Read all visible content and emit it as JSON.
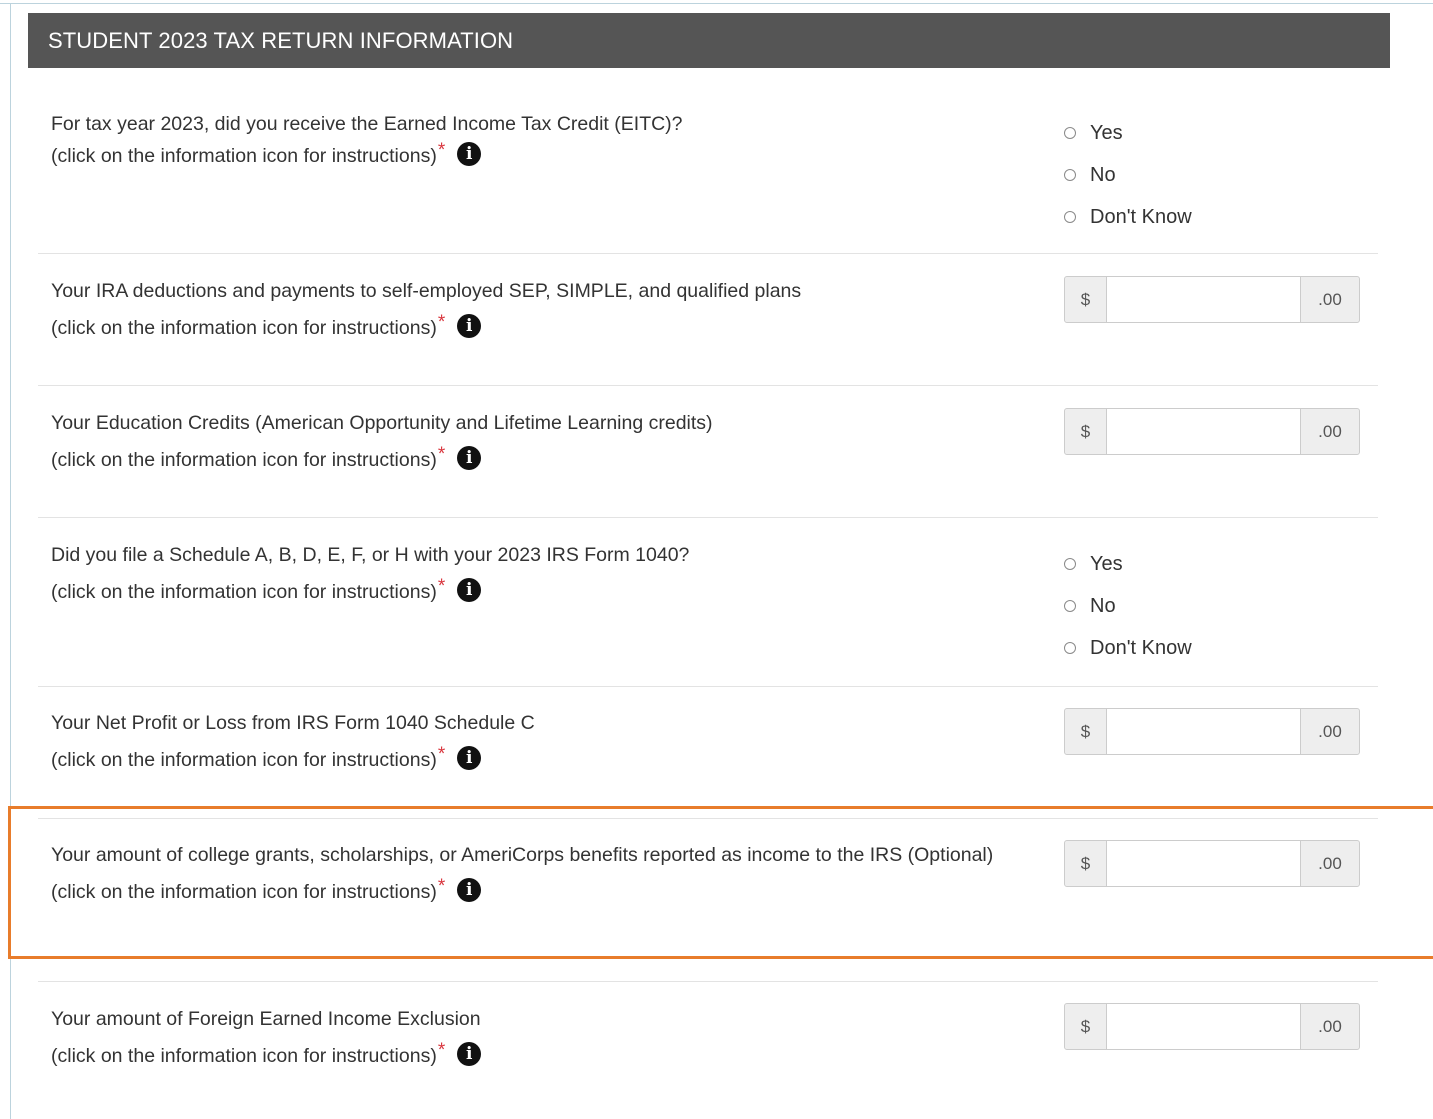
{
  "section": {
    "title": "STUDENT 2023 TAX RETURN INFORMATION"
  },
  "common": {
    "hint": "(click on the information icon for instructions)",
    "required_mark": "*",
    "info_glyph": "i",
    "currency_symbol": "$",
    "cents_suffix": ".00"
  },
  "questions": [
    {
      "text": "For tax year 2023, did you receive the Earned Income Tax Credit (EITC)?",
      "type": "radio",
      "options": [
        "Yes",
        "No",
        "Don't Know"
      ]
    },
    {
      "text": "Your IRA deductions and payments to self-employed SEP, SIMPLE, and qualified plans",
      "type": "money",
      "value": ""
    },
    {
      "text": "Your Education Credits (American Opportunity and Lifetime Learning credits)",
      "type": "money",
      "value": ""
    },
    {
      "text": "Did you file a Schedule A, B, D, E, F, or H with your 2023 IRS Form 1040?",
      "type": "radio",
      "options": [
        "Yes",
        "No",
        "Don't Know"
      ]
    },
    {
      "text": "Your Net Profit or Loss from IRS Form 1040 Schedule C",
      "type": "money",
      "value": ""
    },
    {
      "text": "Your amount of college grants, scholarships, or AmeriCorps benefits reported as income to the IRS (Optional)",
      "type": "money",
      "value": "",
      "highlighted": true
    },
    {
      "text": "Your amount of Foreign Earned Income Exclusion",
      "type": "money",
      "value": ""
    }
  ],
  "colors": {
    "header_bg": "#555555",
    "required": "#d9363e",
    "highlight": "#e87c2b"
  }
}
